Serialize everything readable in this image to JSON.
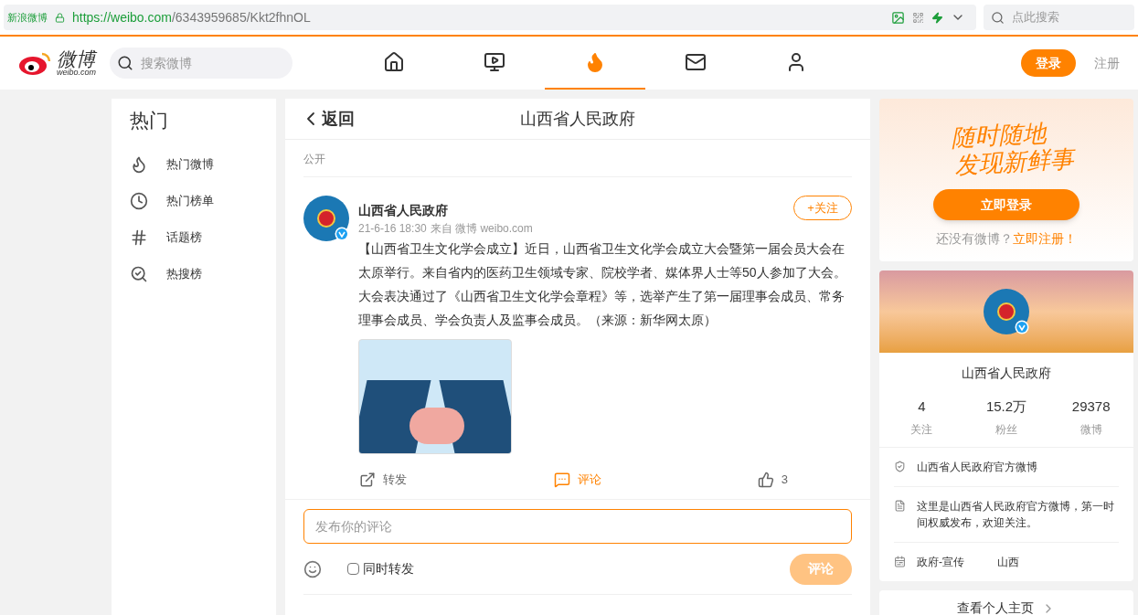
{
  "browser": {
    "site_label": "新浪微博",
    "url_host": "https://weibo.com",
    "url_path": "/6343959685/Kkt2fhnOL",
    "search_placeholder": "点此搜索"
  },
  "header": {
    "logo_text": "微博",
    "logo_sub": "weibo.com",
    "search_placeholder": "搜索微博",
    "login": "登录",
    "register": "注册",
    "nav": [
      {
        "kind": "home",
        "selected": false
      },
      {
        "kind": "video",
        "selected": false
      },
      {
        "kind": "hot",
        "selected": true
      },
      {
        "kind": "mail",
        "selected": false
      },
      {
        "kind": "user",
        "selected": false
      }
    ]
  },
  "sidebar": {
    "title": "热门",
    "items": [
      {
        "kind": "flame",
        "label": "热门微博"
      },
      {
        "kind": "clock",
        "label": "热门榜单"
      },
      {
        "kind": "hash",
        "label": "话题榜"
      },
      {
        "kind": "search",
        "label": "热搜榜"
      }
    ]
  },
  "post_panel": {
    "back": "返回",
    "title": "山西省人民政府",
    "visibility": "公开",
    "post": {
      "author": "山西省人民政府",
      "follow": "+关注",
      "time": "21-6-16 18:30",
      "source": "来自 微博 weibo.com",
      "text": "【山西省卫生文化学会成立】近日，山西省卫生文化学会成立大会暨第一届会员大会在太原举行。来自省内的医药卫生领域专家、院校学者、媒体界人士等50人参加了大会。大会表决通过了《山西省卫生文化学会章程》等，选举产生了第一届理事会成员、常务理事会成员、学会负责人及监事会成员。（来源：新华网太原）"
    },
    "actions": [
      {
        "kind": "repost",
        "label": "转发",
        "selected": false
      },
      {
        "kind": "comment",
        "label": "评论",
        "selected": true
      },
      {
        "kind": "like",
        "label": "3",
        "selected": false
      }
    ],
    "comment_box": {
      "placeholder": "发布你的评论",
      "repost_label": "同时转发",
      "repost_checked": false,
      "submit": "评论",
      "submit_disabled": true
    }
  },
  "login_card": {
    "slogan_1": "随时随地",
    "slogan_2": "发现新鲜事",
    "button": "立即登录",
    "prompt": "还没有微博？",
    "register_link": "立即注册！"
  },
  "profile_card": {
    "name": "山西省人民政府",
    "stats": [
      {
        "value": "4",
        "label": "关注"
      },
      {
        "value": "15.2万",
        "label": "粉丝"
      },
      {
        "value": "29378",
        "label": "微博"
      }
    ],
    "info": [
      {
        "kind": "verified",
        "text": "山西省人民政府官方微博"
      },
      {
        "kind": "intro",
        "text": "这里是山西省人民政府官方微博，第一时间权威发布，欢迎关注。"
      },
      {
        "kind": "tags",
        "text": "政府-宣传",
        "extra": "山西"
      }
    ],
    "more": "查看个人主页"
  }
}
